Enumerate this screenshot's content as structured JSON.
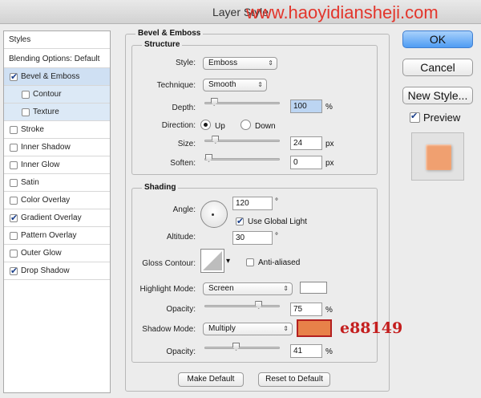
{
  "window": {
    "title": "Layer Style",
    "watermark": "www.haoyidiansheji.com"
  },
  "sidebar": {
    "header": "Styles",
    "blending": "Blending Options: Default",
    "items": [
      {
        "label": "Bevel & Emboss",
        "checked": true
      },
      {
        "label": "Contour",
        "checked": false
      },
      {
        "label": "Texture",
        "checked": false
      },
      {
        "label": "Stroke",
        "checked": false
      },
      {
        "label": "Inner Shadow",
        "checked": false
      },
      {
        "label": "Inner Glow",
        "checked": false
      },
      {
        "label": "Satin",
        "checked": false
      },
      {
        "label": "Color Overlay",
        "checked": false
      },
      {
        "label": "Gradient Overlay",
        "checked": true
      },
      {
        "label": "Pattern Overlay",
        "checked": false
      },
      {
        "label": "Outer Glow",
        "checked": false
      },
      {
        "label": "Drop Shadow",
        "checked": true
      }
    ]
  },
  "bevel": {
    "title": "Bevel & Emboss",
    "structure": {
      "title": "Structure",
      "style_label": "Style:",
      "style_value": "Emboss",
      "technique_label": "Technique:",
      "technique_value": "Smooth",
      "depth_label": "Depth:",
      "depth_value": "100",
      "depth_unit": "%",
      "depth_level": 0.08,
      "direction_label": "Direction:",
      "up_label": "Up",
      "down_label": "Down",
      "size_label": "Size:",
      "size_value": "24",
      "size_unit": "px",
      "size_level": 0.1,
      "soften_label": "Soften:",
      "soften_value": "0",
      "soften_unit": "px",
      "soften_level": 0
    },
    "shading": {
      "title": "Shading",
      "angle_label": "Angle:",
      "angle_value": "120",
      "angle_unit": "°",
      "global_light_label": "Use Global Light",
      "altitude_label": "Altitude:",
      "altitude_value": "30",
      "altitude_unit": "°",
      "gloss_label": "Gloss Contour:",
      "anti_aliased_label": "Anti-aliased",
      "highlight_mode_label": "Highlight Mode:",
      "highlight_mode_value": "Screen",
      "highlight_opacity_label": "Opacity:",
      "highlight_opacity_value": "75",
      "highlight_opacity_unit": "%",
      "highlight_opacity_level": 0.75,
      "shadow_mode_label": "Shadow Mode:",
      "shadow_mode_value": "Multiply",
      "shadow_opacity_label": "Opacity:",
      "shadow_opacity_value": "41",
      "shadow_opacity_unit": "%",
      "shadow_opacity_level": 0.41
    },
    "make_default": "Make Default",
    "reset_default": "Reset to Default"
  },
  "actions": {
    "ok": "OK",
    "cancel": "Cancel",
    "new_style": "New Style...",
    "preview": "Preview"
  },
  "colors": {
    "highlight_color": "#ffffff",
    "shadow_color": "#e88149",
    "preview_fill": "#f0a070",
    "accent": "#4f9cf3"
  },
  "annotation": "e88149"
}
